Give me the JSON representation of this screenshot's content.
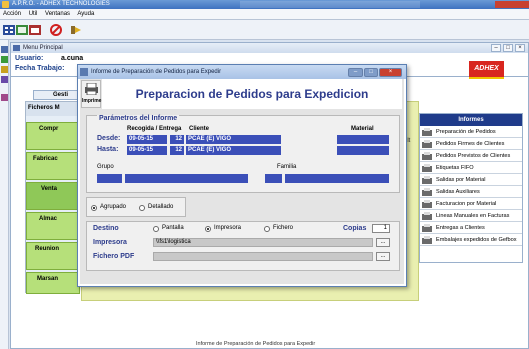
{
  "app": {
    "title": "A.P.R.O. - ADHEX TECHNOLOGIES"
  },
  "menu": [
    "Acción",
    "Util",
    "Ventanas",
    "Ayuda"
  ],
  "inner_window": {
    "title": "Menu Principal"
  },
  "user": {
    "usuario_label": "Usuario:",
    "usuario_value": "a.cuna",
    "fecha_label": "Fecha Trabajo:"
  },
  "gestion_bar": "Gesti",
  "left_buttons": [
    "Ficheros M",
    "Compr",
    "Fabricac",
    "Venta",
    "Almac",
    "Reunion",
    "Marsan"
  ],
  "brand": {
    "logo_text": "ADHEX",
    "colors": {
      "logo_red": "#d8261f",
      "header_navy": "#1f3b8a"
    }
  },
  "right_panel": {
    "header": "Informes",
    "items": [
      "Preparación de Pedidos",
      "Pedidos Firmes de Clientes",
      "Pedidos Previstos de Clientes",
      "Etiquetas FIFO",
      "Salidas por Material",
      "Salidas Auxiliares",
      "Facturacion por Material",
      "Lineas Manuales en Facturas",
      "Entregas a Clientes",
      "Embalajes expedidos de Gefbox"
    ],
    "side_text": "mult"
  },
  "statusbar": "Informe de Preparación de Pedidos para Expedir",
  "dialog": {
    "title": "Informe de Preparación de Pedidos para Expedir",
    "toolbar_label": "Imprime",
    "header": "Preparacion de Pedidos para Expedicion",
    "params_title": "Parámetros del Informe",
    "col_recogida": "Recogida / Entrega",
    "col_cliente": "Cliente",
    "col_material": "Material",
    "desde_label": "Desde:",
    "hasta_label": "Hasta:",
    "desde_fecha": "09-05-15",
    "hasta_fecha": "09-05-15",
    "desde_cliente_num": "12",
    "hasta_cliente_num": "12",
    "desde_cliente_nombre": "PCAE (E) VIGO",
    "hasta_cliente_nombre": "PCAE (E) VIGO",
    "grupo_label": "Grupo",
    "familia_label": "Familia",
    "agrupado_label": "Agrupado",
    "detallado_label": "Detallado",
    "destino_label": "Destino",
    "pantalla_label": "Pantalla",
    "impresora_opt_label": "Impresora",
    "fichero_label": "Fichero",
    "copias_label": "Copias",
    "copias_value": "1",
    "impresora_label": "Impresora",
    "impresora_value": "\\\\fs1\\logistica",
    "fichero_pdf_label": "Fichero PDF",
    "dots": "..."
  }
}
